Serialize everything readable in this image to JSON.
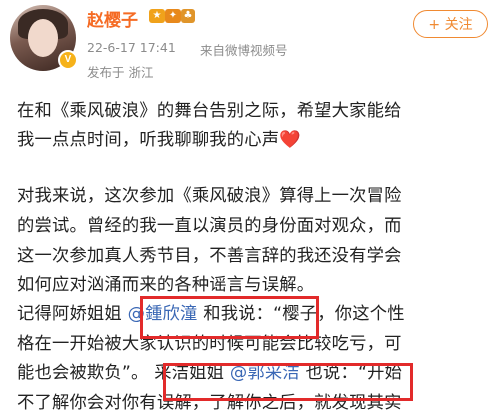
{
  "post": {
    "author": {
      "name": "赵樱子",
      "avatar_icon": "avatar-photo",
      "verified_icon": "verified-badge-icon",
      "badges": [
        "vip-badge-icon",
        "star-badge-icon",
        "tree-badge-icon"
      ]
    },
    "follow_label": "+ 关注",
    "time": "22-6-17 17:41",
    "source": "来自微博视频号",
    "location": "发布于  浙江",
    "lines": {
      "l1": "在和《乘风破浪》的舞台告别之际，希望大家能给",
      "l2a": "我一点点时间，听我聊聊我的心声",
      "l2_heart": "❤️",
      "l3": "对我来说，这次参加《乘风破浪》算得上一次冒险",
      "l4": "的尝试。曾经的我一直以演员的身份面对观众，而",
      "l5": "这一次参加真人秀节目，不善言辞的我还没有学会",
      "l6": "如何应对汹涌而来的各种谣言与误解。",
      "l7a": "记得阿娇姐姐",
      "l7_mention": "@鍾欣潼",
      "l7b": "和我说：“樱子，你这个性",
      "l8": "格在一开始被大家认识的时候可能会比较吃亏，可",
      "l9a": "能也会被欺负”。",
      "l9b": "采洁姐姐",
      "l9_mention": "@郭采洁",
      "l9c": "也说：“开始",
      "l10": "不了解你会对你有误解，了解你之后，就发现其实"
    }
  },
  "colors": {
    "username": "#f56b24",
    "mention": "#3b68b5",
    "highlight_box": "#e22a2a",
    "follow": "#f08a32"
  }
}
